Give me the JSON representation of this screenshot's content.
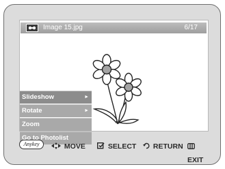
{
  "title_bar": {
    "file_icon": "photo-file-icon",
    "file_name": "Image 15.jpg",
    "counter": "6/17"
  },
  "image": {
    "subject": "flower-drawing"
  },
  "menu": {
    "items": [
      {
        "label": "Slideshow",
        "has_submenu": true,
        "selected": true
      },
      {
        "label": "Rotate",
        "has_submenu": true,
        "selected": false
      },
      {
        "label": "Zoom",
        "has_submenu": false,
        "selected": false
      },
      {
        "label": "Go to Photolist",
        "has_submenu": false,
        "selected": false
      }
    ],
    "submenu_arrow": "►"
  },
  "nav_bar": {
    "anykey_label": "Anykey",
    "move_icon": "◂✥▸",
    "move_label": "MOVE",
    "select_icon": "select-icon",
    "select_label": "SELECT",
    "return_icon": "return-icon",
    "return_label": "RETURN",
    "exit_icon": "exit-icon",
    "exit_label": "EXIT"
  },
  "colors": {
    "frame": "#dcdcdc",
    "menu_bg": "#a9a9a9",
    "title_bar": "#a8a8a8",
    "text_light": "#ffffff",
    "text_dark": "#2a2a2a"
  }
}
